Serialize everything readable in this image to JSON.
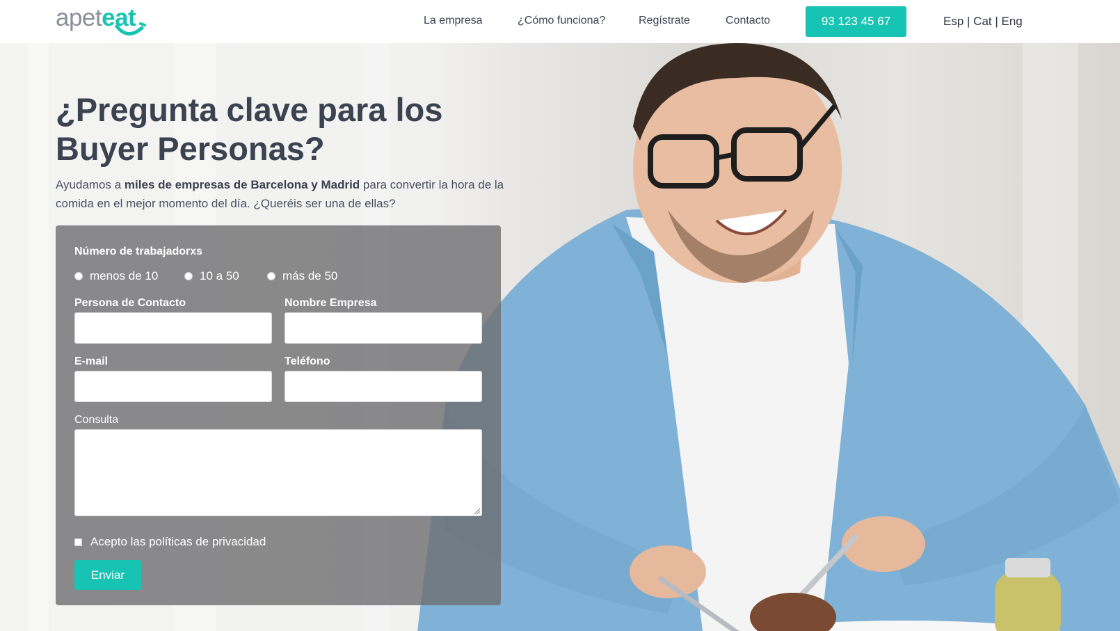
{
  "brand": {
    "logo_part1": "apet",
    "logo_part2": "eat"
  },
  "nav": {
    "items": [
      "La empresa",
      "¿Cómo funciona?",
      "Regístrate",
      "Contacto"
    ],
    "phone": "93 123 45 67",
    "languages": [
      "Esp",
      "Cat",
      "Eng"
    ],
    "lang_separator": " | "
  },
  "hero": {
    "title": "¿Pregunta clave para los Buyer Personas?",
    "intro_pre": "Ayudamos a ",
    "intro_bold": "miles de empresas de Barcelona y Madrid",
    "intro_post": " para convertir la hora de la comida en el mejor momento del día. ¿Queréis ser una de ellas?"
  },
  "form": {
    "workers_label": "Número de trabajadorxs",
    "workers_options": [
      "menos de 10",
      "10 a 50",
      "más de 50"
    ],
    "contact_label": "Persona de Contacto",
    "company_label": "Nombre Empresa",
    "email_label": "E-mail",
    "phone_label": "Teléfono",
    "query_label": "Consulta",
    "privacy_label": "Acepto las políticas de privacidad",
    "submit_label": "Enviar"
  },
  "colors": {
    "accent": "#17c3b2",
    "heading": "#3b4250"
  }
}
